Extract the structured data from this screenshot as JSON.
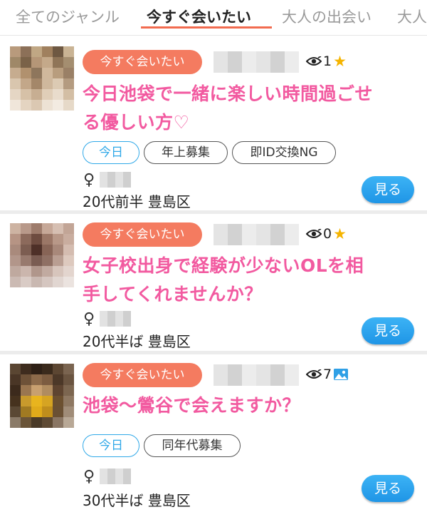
{
  "tabs": [
    {
      "label": "全てのジャンル",
      "active": false
    },
    {
      "label": "今すぐ会いたい",
      "active": true
    },
    {
      "label": "大人の出会い",
      "active": false
    },
    {
      "label": "大人",
      "active": false
    }
  ],
  "colors": {
    "accent": "#f47b60",
    "title": "#f25aa0",
    "today": "#2fa8e8",
    "button": "#1f95e6",
    "star": "#f5b400"
  },
  "posts": [
    {
      "category": "今すぐ会いたい",
      "views": "1",
      "badge_icon": "star-icon",
      "title_line1": "今日池袋で一緒に楽しい時間過ごせ",
      "title_line2": "る優しい方♡",
      "tags": [
        "今日",
        "年上募集",
        "即ID交換NG"
      ],
      "gender": "♀",
      "age_area": "20代前半 豊島区",
      "button": "見る"
    },
    {
      "category": "今すぐ会いたい",
      "views": "0",
      "badge_icon": "star-icon",
      "title_line1": "女子校出身で経験が少ないOLを相",
      "title_line2": "手してくれませんか？",
      "tags": [],
      "gender": "♀",
      "age_area": "20代半ば 豊島区",
      "button": "見る"
    },
    {
      "category": "今すぐ会いたい",
      "views": "7",
      "badge_icon": "image-icon",
      "title_line1": "池袋～鶯谷で会えますか？",
      "title_line2": "",
      "tags": [
        "今日",
        "同年代募集"
      ],
      "gender": "♀",
      "age_area": "30代半ば 豊島区",
      "button": "見る"
    }
  ]
}
